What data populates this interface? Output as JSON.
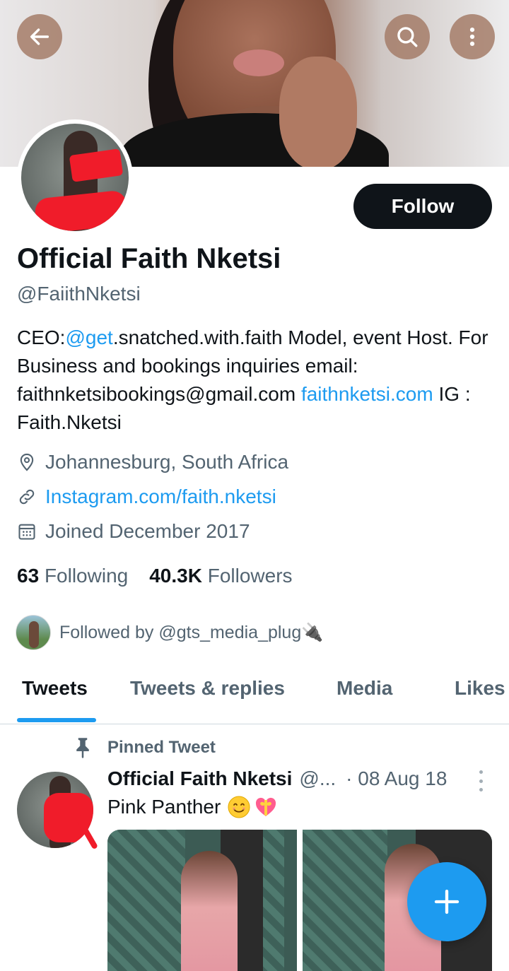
{
  "profile": {
    "name": "Official Faith Nketsi",
    "handle": "@FaiithNketsi",
    "follow_label": "Follow",
    "bio": {
      "p1": "CEO:",
      "mention": "@get",
      "p2": ".snatched.with.faith Model, event Host. For Business and bookings inquiries email: faithnketsibookings@gmail.com ",
      "link": "faithnketsi.com",
      "p3": " IG : Faith.Nketsi"
    },
    "location": "Johannesburg, South Africa",
    "website": "Instagram.com/faith.nketsi",
    "joined": "Joined December 2017",
    "following_count": "63",
    "following_label": "Following",
    "followers_count": "40.3K",
    "followers_label": "Followers",
    "followed_by": "Followed by @gts_media_plug🔌"
  },
  "tabs": [
    {
      "label": "Tweets",
      "active": true
    },
    {
      "label": "Tweets & replies",
      "active": false
    },
    {
      "label": "Media",
      "active": false
    },
    {
      "label": "Likes",
      "active": false
    }
  ],
  "pinned_tweet": {
    "label": "Pinned Tweet",
    "author": "Official Faith Nketsi",
    "handle": "@...",
    "date": "· 08 Aug 18",
    "text": "Pink Panther",
    "emojis": [
      "smiling-face-emoji",
      "heart-with-ribbon-emoji"
    ]
  },
  "icons": {
    "back": "back-arrow-icon",
    "search": "search-icon",
    "more": "more-vertical-icon",
    "location": "location-pin-icon",
    "link": "link-icon",
    "calendar": "calendar-icon",
    "pin": "pin-icon",
    "compose": "plus-icon"
  },
  "colors": {
    "accent": "#1d9bf0",
    "text": "#0f1419",
    "secondary": "#536471",
    "follow_bg": "#0f1419"
  }
}
